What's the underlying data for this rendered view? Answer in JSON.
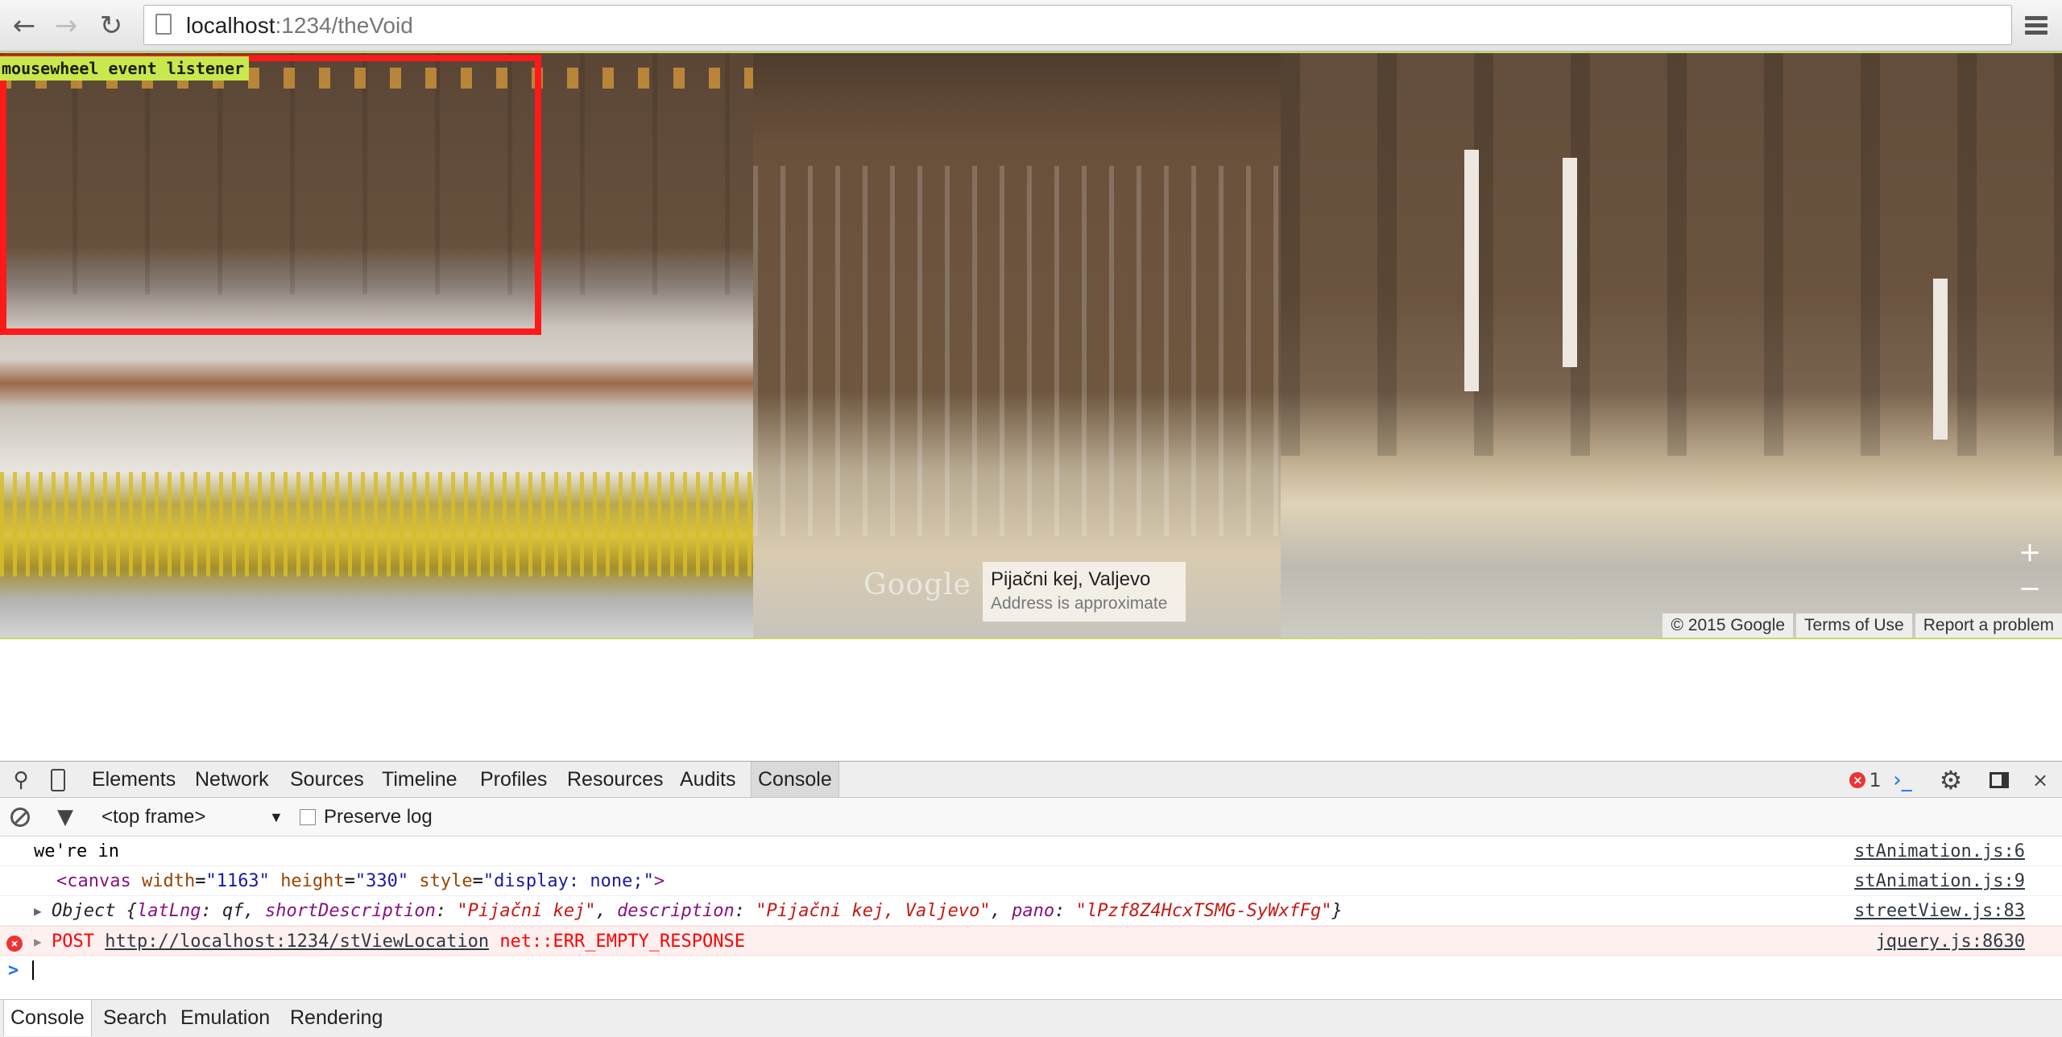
{
  "browser": {
    "url_host": "localhost",
    "url_path": ":1234/theVoid",
    "back_icon": "back-arrow-icon",
    "forward_icon": "forward-arrow-icon",
    "reload_icon": "reload-icon",
    "menu_icon": "hamburger-menu-icon"
  },
  "pano": {
    "mousewheel_label": "mousewheel event listener",
    "google_logo": "Google",
    "address_title": "Pijačni kej, Valjevo",
    "address_sub": "Address is approximate",
    "zoom_in": "+",
    "zoom_out": "−",
    "copyright": "© 2015 Google",
    "terms": "Terms of Use",
    "report": "Report a problem",
    "highlight_color": "#ff1a1a",
    "label_color": "#c9e84d"
  },
  "devtools": {
    "tabs": [
      "Elements",
      "Network",
      "Sources",
      "Timeline",
      "Profiles",
      "Resources",
      "Audits",
      "Console"
    ],
    "error_count": "1",
    "frame_select": "<top frame>",
    "preserve_log": "Preserve log",
    "drawer_tabs": [
      "Console",
      "Search",
      "Emulation",
      "Rendering"
    ],
    "console": [
      {
        "text": "we're in",
        "source": "stAnimation.js:6"
      },
      {
        "source": "stAnimation.js:9",
        "tag_open": "<canvas",
        "attr1": "width",
        "val1": "\"1163\"",
        "attr2": "height",
        "val2": "\"330\"",
        "attr3": "style",
        "val3": "\"display: none;\"",
        "tag_close": ">"
      },
      {
        "source": "streetView.js:83",
        "obj_prefix": "Object {",
        "k1": "latLng",
        "v1": "qf",
        "k2": "shortDescription",
        "v2": "\"Pijačni kej\"",
        "k3": "description",
        "v3": "\"Pijačni kej, Valjevo\"",
        "k4": "pano",
        "v4": "\"lPzf8Z4HcxTSMG-SyWxfFg\"",
        "obj_suffix": "}"
      },
      {
        "method": "POST",
        "url": "http://localhost:1234/stViewLocation",
        "error": "net::ERR_EMPTY_RESPONSE",
        "source": "jquery.js:8630"
      }
    ],
    "prompt": ">"
  }
}
